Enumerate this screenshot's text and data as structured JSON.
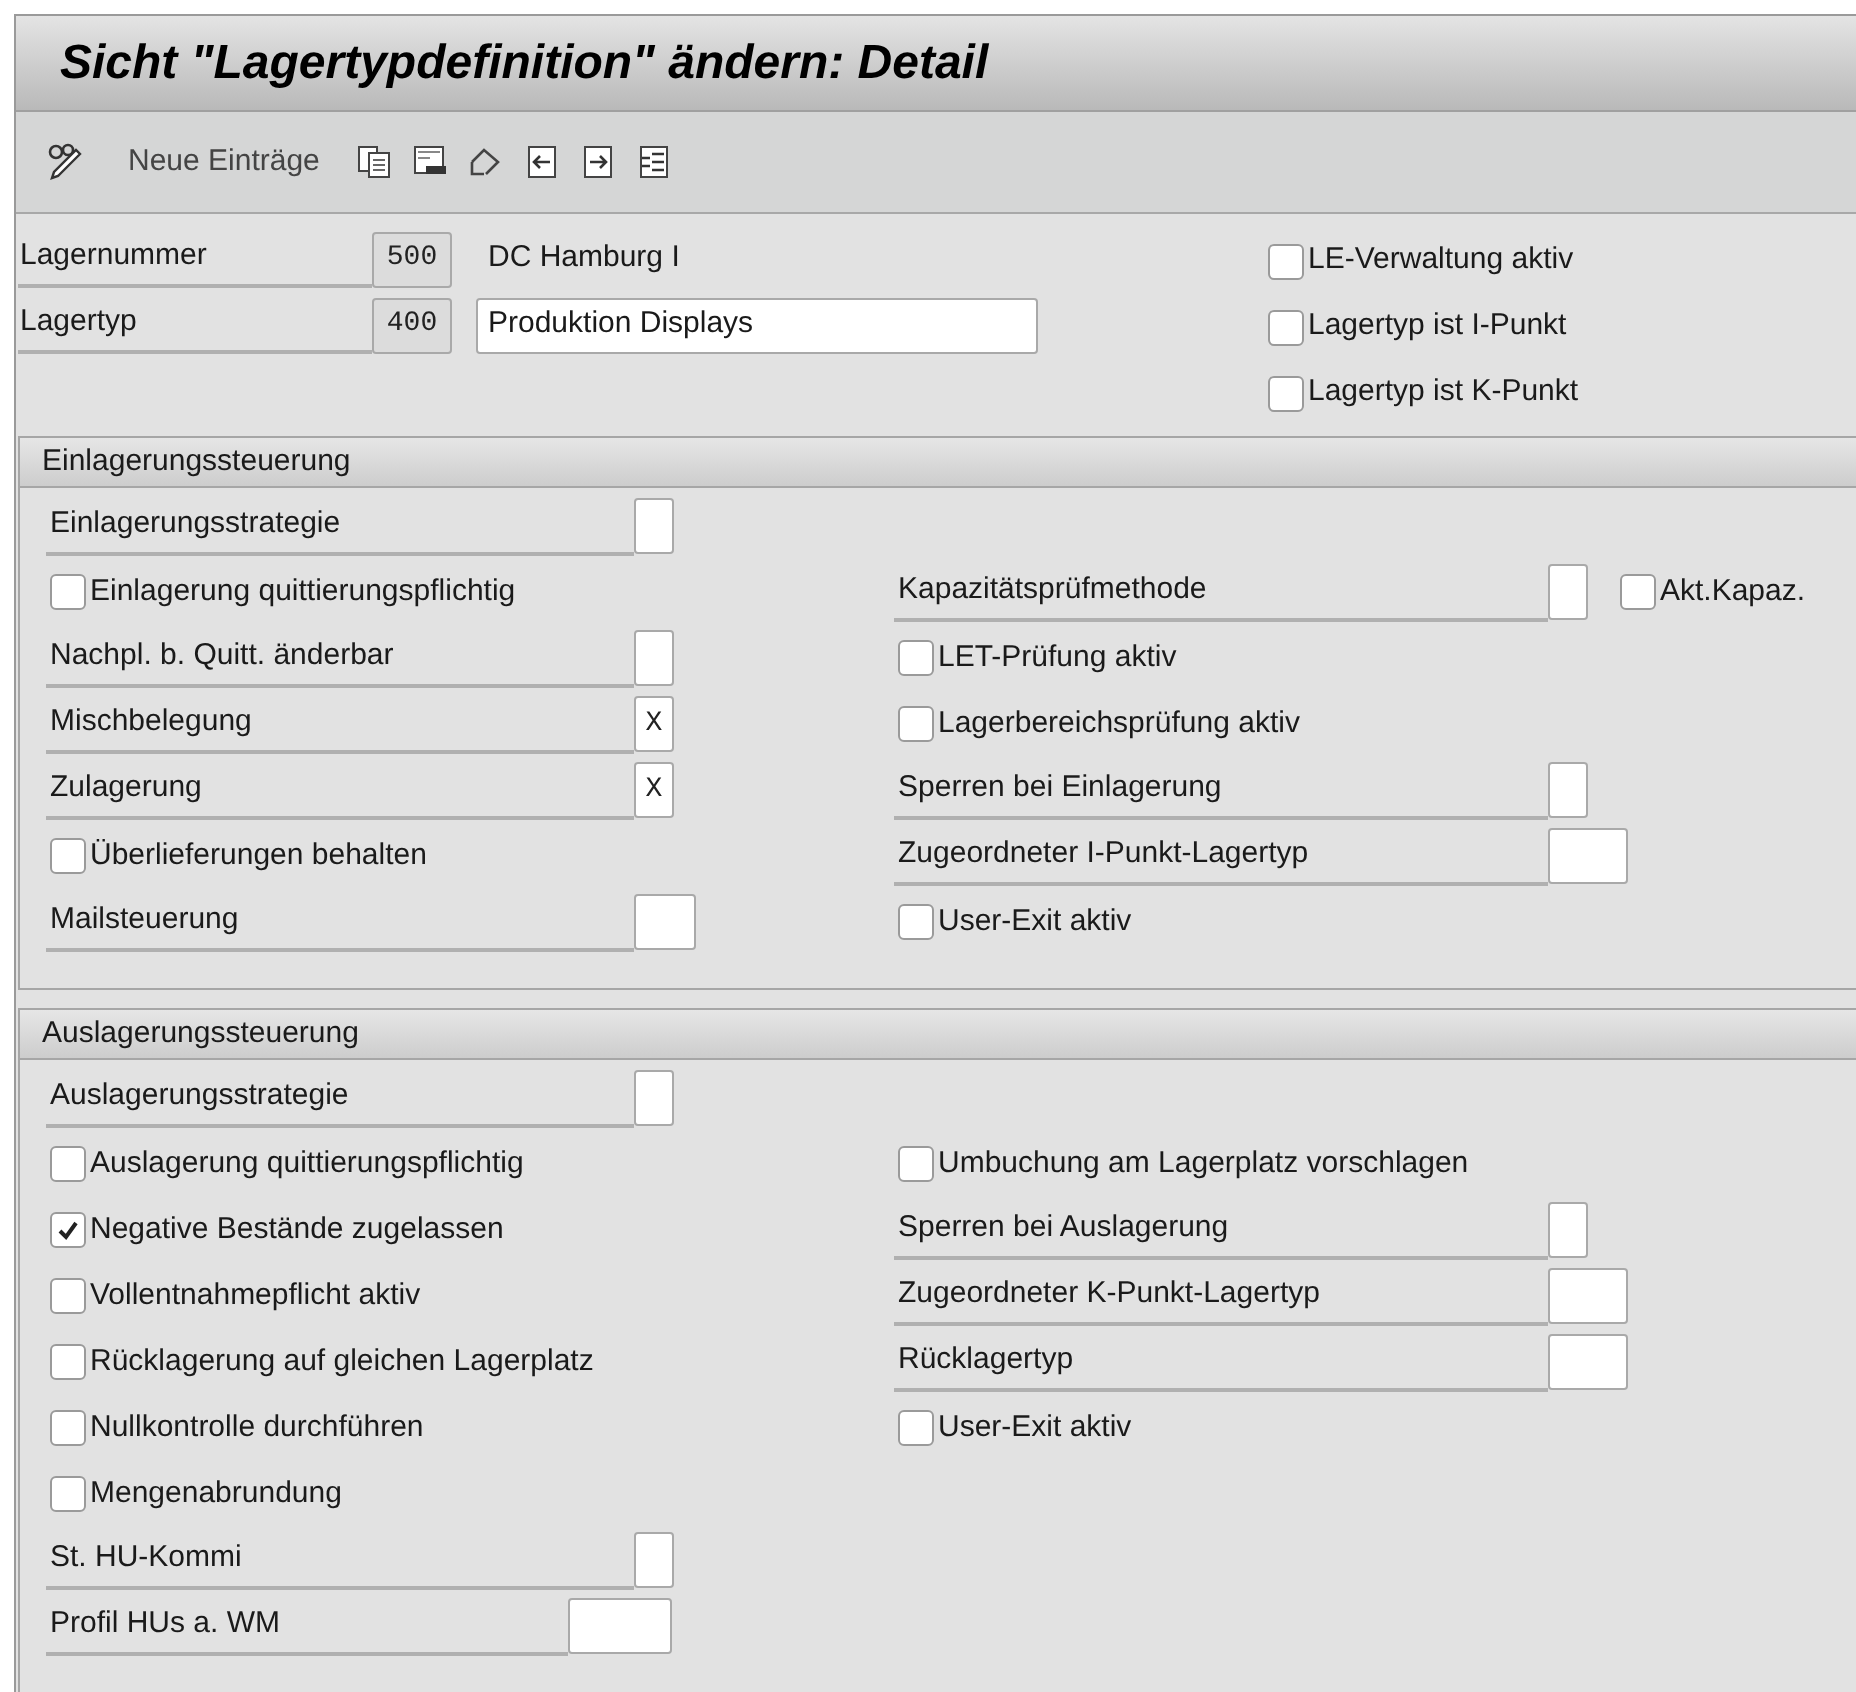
{
  "window": {
    "title": "Sicht \"Lagertypdefinition\" ändern: Detail"
  },
  "toolbar": {
    "new_entries": "Neue Einträge"
  },
  "header": {
    "fields": [
      {
        "label": "Lagernummer",
        "value": "500",
        "description": {
          "kind": "text",
          "text": "DC Hamburg I"
        }
      },
      {
        "label": "Lagertyp",
        "value": "400",
        "description": {
          "kind": "field",
          "text": "Produktion Displays"
        }
      }
    ],
    "checkboxes": [
      {
        "label": "LE-Verwaltung aktiv",
        "checked": false
      },
      {
        "label": "Lagertyp ist I-Punkt",
        "checked": false
      },
      {
        "label": "Lagertyp ist K-Punkt",
        "checked": false
      }
    ]
  },
  "sections": [
    {
      "title": "Einlagerungssteuerung",
      "rows": [
        {
          "left": [
            {
              "kind": "field_short",
              "label": "Einlagerungsstrategie"
            }
          ]
        },
        {
          "left": [
            {
              "kind": "checkbox",
              "label": "Einlagerung quittierungspflichtig",
              "checked": false
            }
          ],
          "right": [
            {
              "kind": "field_short",
              "label": "Kapazitätsprüfmethode"
            },
            {
              "kind": "checkbox",
              "label": "Akt.Kapaz.",
              "checked": false
            }
          ]
        },
        {
          "left": [
            {
              "kind": "field_short",
              "label": "Nachpl. b. Quitt. änderbar"
            }
          ],
          "right": [
            {
              "kind": "checkbox",
              "label": "LET-Prüfung aktiv",
              "checked": false
            }
          ]
        },
        {
          "left": [
            {
              "kind": "field_short",
              "label": "Mischbelegung",
              "value": "X"
            }
          ],
          "right": [
            {
              "kind": "checkbox",
              "label": "Lagerbereichsprüfung aktiv",
              "checked": false
            }
          ]
        },
        {
          "left": [
            {
              "kind": "field_short",
              "label": "Zulagerung",
              "value": "X"
            }
          ],
          "right": [
            {
              "kind": "field_short",
              "label": "Sperren bei Einlagerung"
            }
          ]
        },
        {
          "left": [
            {
              "kind": "checkbox",
              "label": "Überlieferungen behalten",
              "checked": false
            }
          ],
          "right": [
            {
              "kind": "field_medium",
              "label": "Zugeordneter I-Punkt-Lagertyp"
            }
          ]
        },
        {
          "left": [
            {
              "kind": "field_medium",
              "label": "Mailsteuerung"
            }
          ],
          "right": [
            {
              "kind": "checkbox",
              "label": "User-Exit aktiv",
              "checked": false
            }
          ]
        }
      ]
    },
    {
      "title": "Auslagerungssteuerung",
      "rows": [
        {
          "left": [
            {
              "kind": "field_short",
              "label": "Auslagerungsstrategie"
            }
          ]
        },
        {
          "left": [
            {
              "kind": "checkbox",
              "label": "Auslagerung quittierungspflichtig",
              "checked": false
            }
          ],
          "right": [
            {
              "kind": "checkbox",
              "label": "Umbuchung am Lagerplatz vorschlagen",
              "checked": false
            }
          ]
        },
        {
          "left": [
            {
              "kind": "checkbox",
              "label": "Negative Bestände zugelassen",
              "checked": true
            }
          ],
          "right": [
            {
              "kind": "field_short",
              "label": "Sperren bei Auslagerung"
            }
          ]
        },
        {
          "left": [
            {
              "kind": "checkbox",
              "label": "Vollentnahmepflicht aktiv",
              "checked": false
            }
          ],
          "right": [
            {
              "kind": "field_medium",
              "label": "Zugeordneter K-Punkt-Lagertyp"
            }
          ]
        },
        {
          "left": [
            {
              "kind": "checkbox",
              "label": "Rücklagerung auf gleichen Lagerplatz",
              "checked": false
            }
          ],
          "right": [
            {
              "kind": "field_medium",
              "label": "Rücklagertyp"
            }
          ]
        },
        {
          "left": [
            {
              "kind": "checkbox",
              "label": "Nullkontrolle durchführen",
              "checked": false
            }
          ],
          "right": [
            {
              "kind": "checkbox",
              "label": "User-Exit aktiv",
              "checked": false
            }
          ]
        },
        {
          "left": [
            {
              "kind": "checkbox",
              "label": "Mengenabrundung",
              "checked": false
            }
          ]
        },
        {
          "left": [
            {
              "kind": "field_short",
              "label": "St. HU-Kommi"
            }
          ]
        },
        {
          "left": [
            {
              "kind": "field_long",
              "label": "Profil HUs a. WM"
            }
          ]
        }
      ]
    }
  ]
}
